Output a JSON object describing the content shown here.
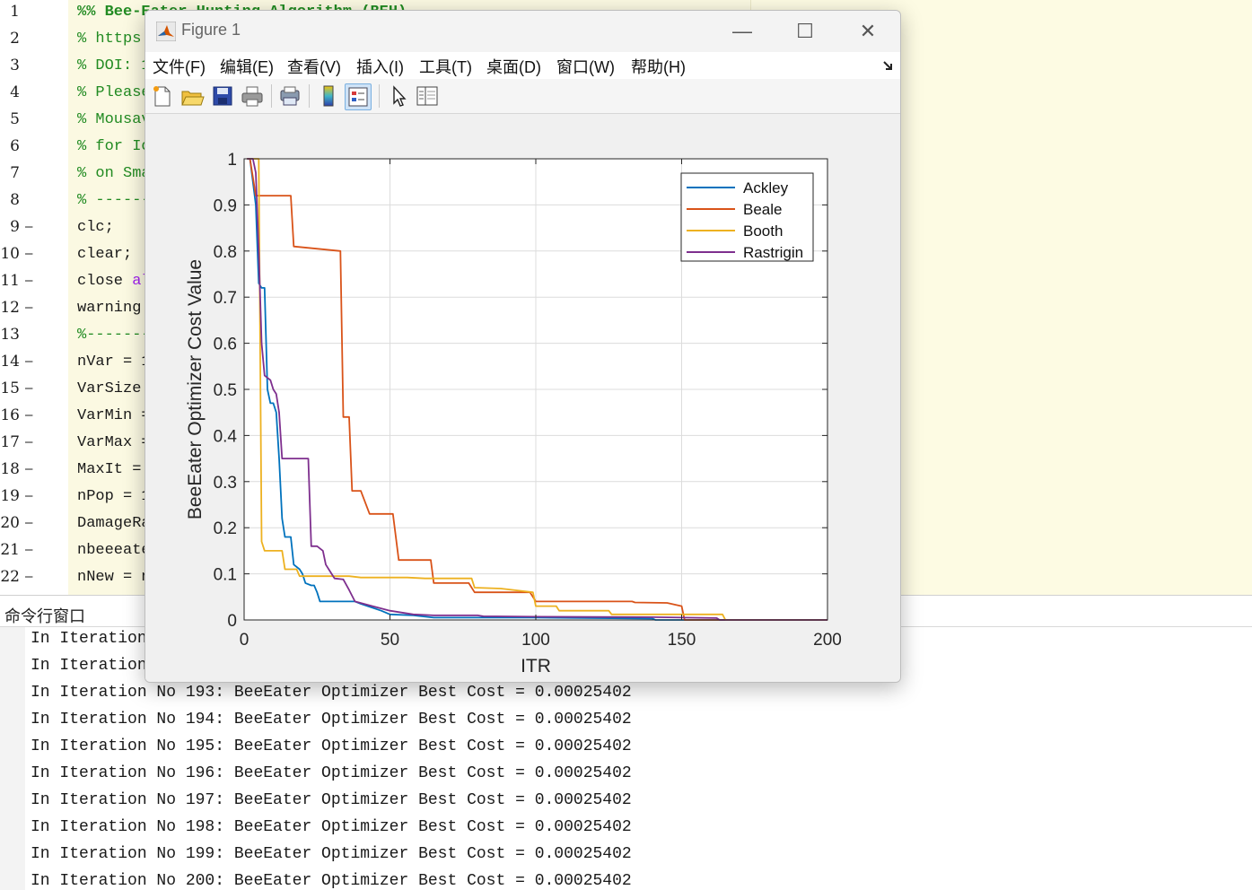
{
  "editor": {
    "lines": [
      {
        "n": "1",
        "dash": false,
        "parts": [
          {
            "t": "%% Bee-Eater Hunting Algorithm (BEH)",
            "c": "cmb"
          }
        ]
      },
      {
        "n": "2",
        "dash": false,
        "parts": [
          {
            "t": "% https:",
            "c": "cm"
          }
        ]
      },
      {
        "n": "3",
        "dash": false,
        "parts": [
          {
            "t": "% DOI: 1",
            "c": "cm"
          }
        ]
      },
      {
        "n": "4",
        "dash": false,
        "parts": [
          {
            "t": "% Please",
            "c": "cm"
          }
        ]
      },
      {
        "n": "5",
        "dash": false,
        "parts": [
          {
            "t": "% Mousav",
            "c": "cm"
          }
        ]
      },
      {
        "n": "6",
        "dash": false,
        "parts": [
          {
            "t": "% for Io",
            "c": "cm"
          }
        ]
      },
      {
        "n": "7",
        "dash": false,
        "parts": [
          {
            "t": "% on Sma",
            "c": "cm"
          }
        ]
      },
      {
        "n": "8",
        "dash": false,
        "parts": [
          {
            "t": "% ------",
            "c": "cm"
          }
        ]
      },
      {
        "n": "9",
        "dash": true,
        "parts": [
          {
            "t": "clc;",
            "c": ""
          }
        ]
      },
      {
        "n": "10",
        "dash": true,
        "parts": [
          {
            "t": "clear;",
            "c": ""
          }
        ]
      },
      {
        "n": "11",
        "dash": true,
        "parts": [
          {
            "t": "close ",
            "c": ""
          },
          {
            "t": "al",
            "c": "str"
          }
        ]
      },
      {
        "n": "12",
        "dash": true,
        "parts": [
          {
            "t": "warning",
            "c": ""
          }
        ]
      },
      {
        "n": "13",
        "dash": false,
        "parts": [
          {
            "t": "%-------",
            "c": "cm"
          }
        ]
      },
      {
        "n": "14",
        "dash": true,
        "parts": [
          {
            "t": "nVar = 1",
            "c": ""
          }
        ]
      },
      {
        "n": "15",
        "dash": true,
        "parts": [
          {
            "t": "VarSize",
            "c": ""
          }
        ]
      },
      {
        "n": "16",
        "dash": true,
        "parts": [
          {
            "t": "VarMin =",
            "c": ""
          }
        ]
      },
      {
        "n": "17",
        "dash": true,
        "parts": [
          {
            "t": "VarMax =",
            "c": ""
          }
        ]
      },
      {
        "n": "18",
        "dash": true,
        "parts": [
          {
            "t": "MaxIt =",
            "c": ""
          }
        ]
      },
      {
        "n": "19",
        "dash": true,
        "parts": [
          {
            "t": "nPop = 1",
            "c": ""
          }
        ]
      },
      {
        "n": "20",
        "dash": true,
        "parts": [
          {
            "t": "DamageRa",
            "c": ""
          }
        ]
      },
      {
        "n": "21",
        "dash": true,
        "parts": [
          {
            "t": "nbeeeate",
            "c": ""
          }
        ]
      },
      {
        "n": "22",
        "dash": true,
        "parts": [
          {
            "t": "nNew = n",
            "c": ""
          }
        ]
      }
    ]
  },
  "command_window": {
    "title": "命令行窗口",
    "lines": [
      "In Iteration",
      "In Iteration",
      "In Iteration No 193: BeeEater Optimizer Best Cost = 0.00025402",
      "In Iteration No 194: BeeEater Optimizer Best Cost = 0.00025402",
      "In Iteration No 195: BeeEater Optimizer Best Cost = 0.00025402",
      "In Iteration No 196: BeeEater Optimizer Best Cost = 0.00025402",
      "In Iteration No 197: BeeEater Optimizer Best Cost = 0.00025402",
      "In Iteration No 198: BeeEater Optimizer Best Cost = 0.00025402",
      "In Iteration No 199: BeeEater Optimizer Best Cost = 0.00025402",
      "In Iteration No 200: BeeEater Optimizer Best Cost = 0.00025402"
    ]
  },
  "figure": {
    "title": "Figure 1",
    "menu": [
      "文件(F)",
      "编辑(E)",
      "查看(V)",
      "插入(I)",
      "工具(T)",
      "桌面(D)",
      "窗口(W)",
      "帮助(H)"
    ],
    "toolbar_icons": [
      "new-figure-icon",
      "open-file-icon",
      "save-icon",
      "print-icon",
      "print-preview-icon",
      "colorbar-icon",
      "legend-icon",
      "pointer-icon",
      "property-inspector-icon"
    ],
    "window_buttons": {
      "minimize": "—",
      "maximize": "☐",
      "close": "✕"
    }
  },
  "chart_data": {
    "type": "line",
    "xlabel": "ITR",
    "ylabel": "BeeEater Optimizer Cost Value",
    "xlim": [
      0,
      200
    ],
    "ylim": [
      0,
      1
    ],
    "xticks": [
      "0",
      "50",
      "100",
      "150",
      "200"
    ],
    "yticks": [
      "0",
      "0.1",
      "0.2",
      "0.3",
      "0.4",
      "0.5",
      "0.6",
      "0.7",
      "0.8",
      "0.9",
      "1"
    ],
    "grid": true,
    "legend_position": "top-right",
    "series": [
      {
        "name": "Ackley",
        "color": "#0072BD",
        "points": [
          [
            1,
            1
          ],
          [
            2,
            1
          ],
          [
            3,
            0.95
          ],
          [
            4,
            0.9
          ],
          [
            5,
            0.73
          ],
          [
            6,
            0.72
          ],
          [
            7,
            0.72
          ],
          [
            8,
            0.5
          ],
          [
            9,
            0.47
          ],
          [
            10,
            0.47
          ],
          [
            11,
            0.45
          ],
          [
            12,
            0.35
          ],
          [
            13,
            0.22
          ],
          [
            14,
            0.18
          ],
          [
            16,
            0.18
          ],
          [
            17,
            0.12
          ],
          [
            19,
            0.11
          ],
          [
            20,
            0.1
          ],
          [
            21,
            0.08
          ],
          [
            23,
            0.075
          ],
          [
            24,
            0.075
          ],
          [
            25,
            0.06
          ],
          [
            26,
            0.04
          ],
          [
            38,
            0.04
          ],
          [
            40,
            0.035
          ],
          [
            47,
            0.02
          ],
          [
            50,
            0.012
          ],
          [
            58,
            0.01
          ],
          [
            65,
            0.005
          ],
          [
            100,
            0.005
          ],
          [
            140,
            0.003
          ],
          [
            141,
            0
          ],
          [
            200,
            0
          ]
        ]
      },
      {
        "name": "Beale",
        "color": "#D95319",
        "points": [
          [
            1,
            1
          ],
          [
            2,
            1
          ],
          [
            3,
            0.96
          ],
          [
            4,
            0.92
          ],
          [
            16,
            0.92
          ],
          [
            17,
            0.81
          ],
          [
            33,
            0.8
          ],
          [
            34,
            0.44
          ],
          [
            36,
            0.44
          ],
          [
            37,
            0.28
          ],
          [
            40,
            0.28
          ],
          [
            43,
            0.23
          ],
          [
            51,
            0.23
          ],
          [
            53,
            0.13
          ],
          [
            64,
            0.13
          ],
          [
            65,
            0.08
          ],
          [
            77,
            0.08
          ],
          [
            79,
            0.06
          ],
          [
            98,
            0.06
          ],
          [
            100,
            0.04
          ],
          [
            133,
            0.04
          ],
          [
            134,
            0.038
          ],
          [
            145,
            0.037
          ],
          [
            150,
            0.03
          ],
          [
            151,
            0
          ],
          [
            200,
            0
          ]
        ]
      },
      {
        "name": "Booth",
        "color": "#EDB120",
        "points": [
          [
            1,
            1
          ],
          [
            2,
            1
          ],
          [
            5,
            1
          ],
          [
            6,
            0.17
          ],
          [
            7,
            0.15
          ],
          [
            13,
            0.15
          ],
          [
            14,
            0.11
          ],
          [
            18,
            0.11
          ],
          [
            19,
            0.095
          ],
          [
            36,
            0.095
          ],
          [
            40,
            0.092
          ],
          [
            56,
            0.092
          ],
          [
            62,
            0.09
          ],
          [
            78,
            0.09
          ],
          [
            79,
            0.07
          ],
          [
            88,
            0.068
          ],
          [
            99,
            0.06
          ],
          [
            100,
            0.03
          ],
          [
            107,
            0.03
          ],
          [
            108,
            0.02
          ],
          [
            125,
            0.02
          ],
          [
            126,
            0.012
          ],
          [
            164,
            0.012
          ],
          [
            165,
            0
          ],
          [
            200,
            0
          ]
        ]
      },
      {
        "name": "Rastrigin",
        "color": "#7E2F8E",
        "points": [
          [
            1,
            1
          ],
          [
            3,
            1
          ],
          [
            4,
            0.97
          ],
          [
            5,
            0.8
          ],
          [
            6,
            0.6
          ],
          [
            7,
            0.53
          ],
          [
            9,
            0.52
          ],
          [
            10,
            0.5
          ],
          [
            11,
            0.49
          ],
          [
            12,
            0.45
          ],
          [
            13,
            0.35
          ],
          [
            22,
            0.35
          ],
          [
            23,
            0.16
          ],
          [
            25,
            0.16
          ],
          [
            27,
            0.15
          ],
          [
            28,
            0.12
          ],
          [
            30,
            0.1
          ],
          [
            31,
            0.09
          ],
          [
            34,
            0.088
          ],
          [
            36,
            0.065
          ],
          [
            38,
            0.04
          ],
          [
            44,
            0.03
          ],
          [
            50,
            0.02
          ],
          [
            58,
            0.012
          ],
          [
            65,
            0.01
          ],
          [
            80,
            0.01
          ],
          [
            82,
            0.008
          ],
          [
            100,
            0.007
          ],
          [
            140,
            0.006
          ],
          [
            162,
            0.004
          ],
          [
            163,
            0
          ],
          [
            200,
            0
          ]
        ]
      }
    ]
  }
}
